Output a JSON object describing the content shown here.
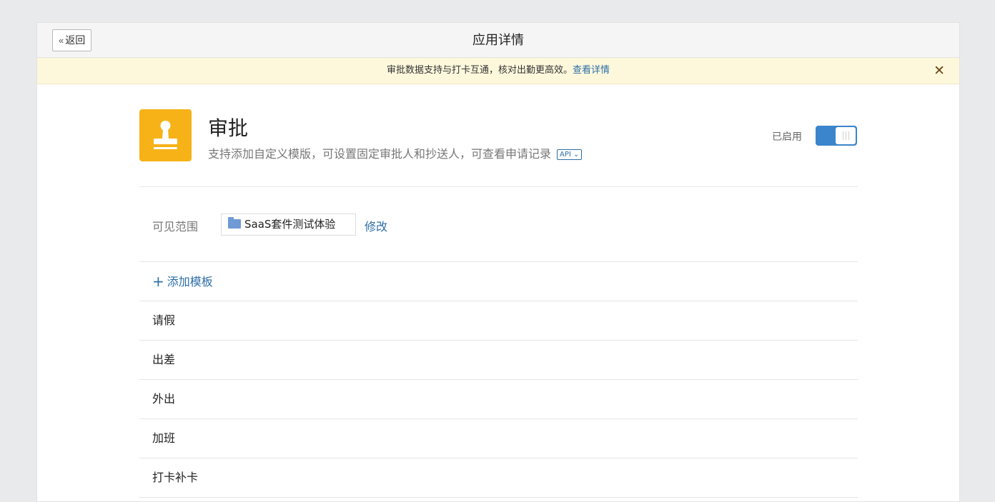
{
  "header": {
    "back_label": "返回",
    "title": "应用详情"
  },
  "banner": {
    "text": "审批数据支持与打卡互通，核对出勤更高效。",
    "link": "查看详情",
    "close_icon": "close-icon"
  },
  "app": {
    "name": "审批",
    "description": "支持添加自定义模版，可设置固定审批人和抄送人，可查看申请记录",
    "api_tag": "API",
    "icon": "stamp-icon",
    "icon_color": "#f6b217",
    "status_label": "已启用",
    "enabled": true
  },
  "scope": {
    "label": "可见范围",
    "value": "SaaS套件测试体验",
    "modify_label": "修改"
  },
  "templates": {
    "add_label": "添加模板",
    "items": [
      "请假",
      "出差",
      "外出",
      "加班",
      "打卡补卡"
    ]
  },
  "colors": {
    "accent": "#3b85cc",
    "link": "#2d6ea8",
    "banner_bg": "#fdf8dc"
  }
}
